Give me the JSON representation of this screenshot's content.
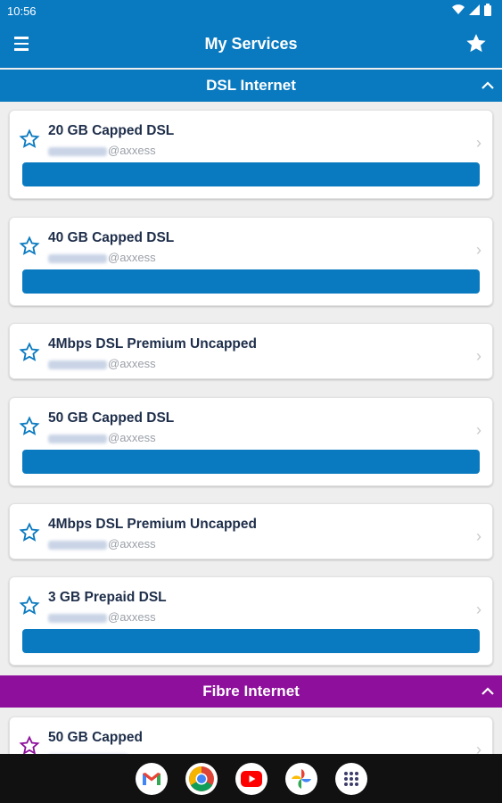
{
  "status": {
    "time": "10:56"
  },
  "appbar": {
    "title": "My Services"
  },
  "sections": {
    "dsl": {
      "title": "DSL Internet"
    },
    "fibre": {
      "title": "Fibre Internet"
    }
  },
  "services": [
    {
      "name": "20 GB Capped DSL",
      "user_suffix": "@axxess"
    },
    {
      "name": "40 GB Capped DSL",
      "user_suffix": "@axxess"
    },
    {
      "name": "4Mbps DSL Premium Uncapped",
      "user_suffix": "@axxess"
    },
    {
      "name": "50 GB Capped DSL",
      "user_suffix": "@axxess"
    },
    {
      "name": "4Mbps DSL Premium Uncapped",
      "user_suffix": "@axxess"
    },
    {
      "name": "3 GB Prepaid DSL",
      "user_suffix": "@axxess"
    },
    {
      "name": "50 GB Capped"
    }
  ],
  "colors": {
    "primary": "#0a7ac0",
    "fibre": "#8e0f9c"
  },
  "dock": [
    "gmail-icon",
    "chrome-icon",
    "youtube-icon",
    "photos-icon",
    "apps-icon"
  ]
}
